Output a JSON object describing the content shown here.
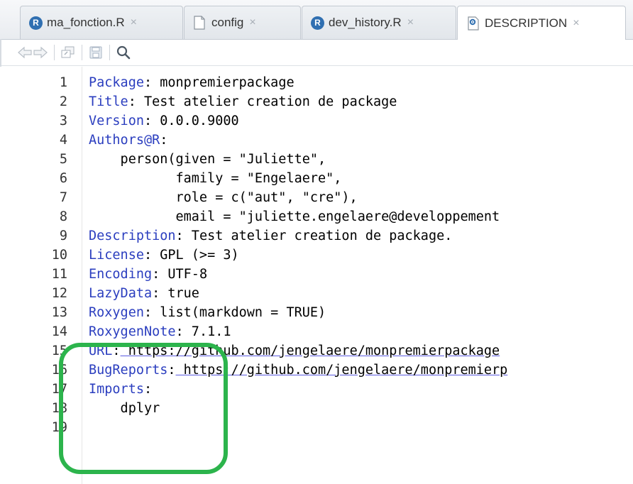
{
  "tabs": [
    {
      "label": "ma_fonction.R",
      "icon": "r-file-icon",
      "active": false
    },
    {
      "label": "config",
      "icon": "text-file-icon",
      "active": false
    },
    {
      "label": "dev_history.R",
      "icon": "r-file-icon",
      "active": false
    },
    {
      "label": "DESCRIPTION",
      "icon": "gear-file-icon",
      "active": true
    }
  ],
  "tab_close_glyph": "×",
  "toolbar": {
    "items": [
      "back-arrow-icon",
      "forward-arrow-icon",
      "show-in-window-icon",
      "save-icon",
      "search-icon"
    ]
  },
  "editor": {
    "lines": [
      {
        "n": "1",
        "key": "Package",
        "rest": " monpremierpackage"
      },
      {
        "n": "2",
        "key": "Title",
        "rest": " Test atelier creation de package"
      },
      {
        "n": "3",
        "key": "Version",
        "rest": " 0.0.0.9000"
      },
      {
        "n": "4",
        "key": "Authors@R",
        "rest": ""
      },
      {
        "n": "5",
        "key": "",
        "rest": "    person(given = \"Juliette\","
      },
      {
        "n": "6",
        "key": "",
        "rest": "           family = \"Engelaere\","
      },
      {
        "n": "7",
        "key": "",
        "rest": "           role = c(\"aut\", \"cre\"),"
      },
      {
        "n": "8",
        "key": "",
        "rest": "           email = \"juliette.engelaere@developpement"
      },
      {
        "n": "9",
        "key": "Description",
        "rest": " Test atelier creation de package."
      },
      {
        "n": "10",
        "key": "License",
        "rest": " GPL (>= 3)"
      },
      {
        "n": "11",
        "key": "Encoding",
        "rest": " UTF-8"
      },
      {
        "n": "12",
        "key": "LazyData",
        "rest": " true"
      },
      {
        "n": "13",
        "key": "Roxygen",
        "rest": " list(markdown = TRUE)"
      },
      {
        "n": "14",
        "key": "RoxygenNote",
        "rest": " 7.1.1"
      },
      {
        "n": "15",
        "key": "URL",
        "rest": " https://github.com/jengelaere/monpremierpackage"
      },
      {
        "n": "16",
        "key": "BugReports",
        "rest": " https://github.com/jengelaere/monpremierp"
      },
      {
        "n": "17",
        "key": "Imports",
        "rest": ""
      },
      {
        "n": "18",
        "key": "",
        "rest": "    dplyr"
      },
      {
        "n": "19",
        "key": "",
        "rest": ""
      }
    ]
  },
  "colors": {
    "keyword": "#2b3ebf",
    "highlight": "#2cb44c"
  }
}
